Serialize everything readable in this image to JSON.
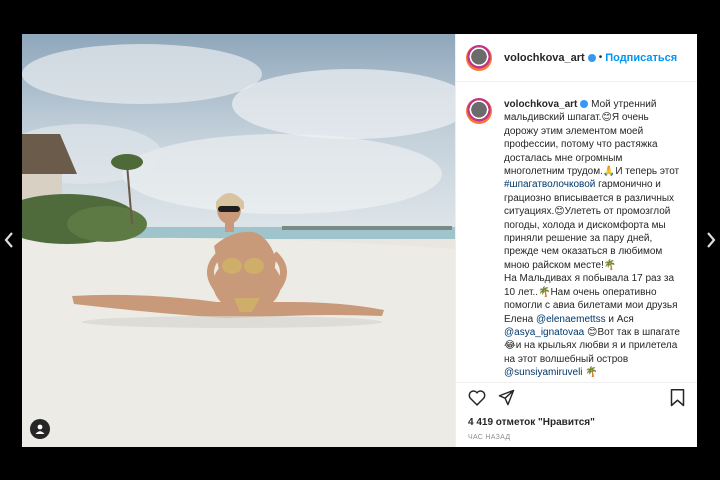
{
  "post": {
    "username": "volochkova_art",
    "follow_label": "Подписаться",
    "dot": "•",
    "caption_intro": "Мой утренний мальдивский шпагат.",
    "caption_1": "Я очень дорожу этим элементом моей профессии, потому что растяжка досталась мне огромным многолетним трудом.",
    "caption_2": "И теперь этот ",
    "hashtag": "#шпагатволочковой",
    "caption_3": " гармонично и грациозно вписывается в различных ситуациях.",
    "caption_4": "Улететь от промозглой погоды, холода и дискомфорта мы приняли решение за пару дней, прежде чем оказаться в любимом мною райском месте!",
    "caption_5": "На Мальдивах я побывала 17 раз за 10 лет..",
    "caption_6": "Нам очень оперативно помогли с авиа билетами мои друзья Елена ",
    "mention_1": "@elenaemettss",
    "caption_7": " и Ася ",
    "mention_2": "@asya_ignatovaa",
    "caption_8": "Вот так в шпагате",
    "caption_9": "и на крыльях любви я и прилетела на этот волшебный остров ",
    "mention_3": "@sunsiyamiruveli",
    "likes": "4 419 отметок \"Нравится\"",
    "time": "ЧАС НАЗАД"
  },
  "emoji": {
    "smile": "😊",
    "pray": "🙏",
    "palm": "🌴",
    "laugh": "😂"
  },
  "icons": [
    "heart-icon",
    "share-icon",
    "bookmark-icon",
    "user-tag-icon",
    "chevron-left-icon",
    "chevron-right-icon",
    "verified-icon"
  ],
  "colors": {
    "background": "#000000",
    "link": "#0095f6",
    "mention": "#00376b",
    "verified": "#3897f0"
  }
}
